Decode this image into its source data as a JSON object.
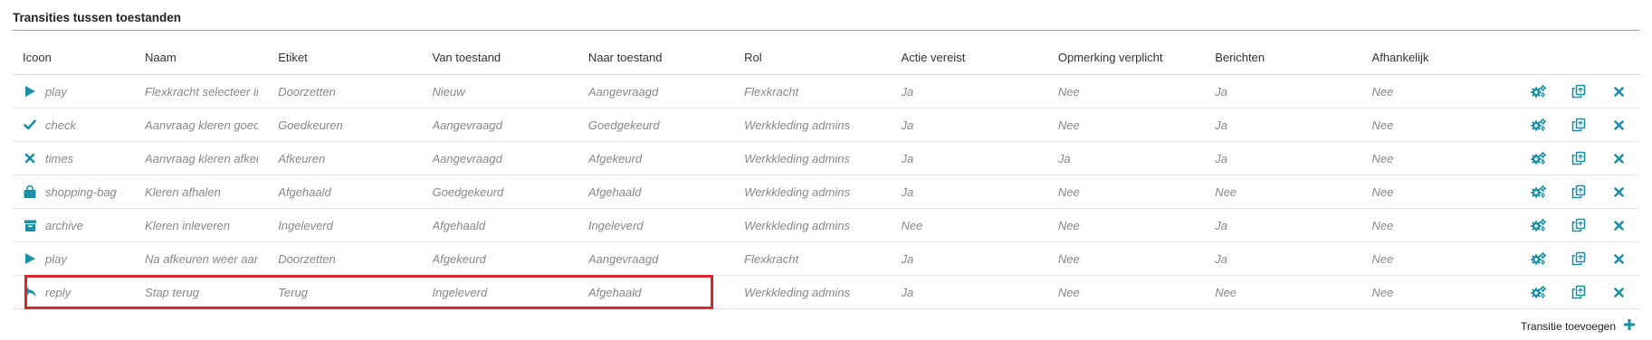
{
  "panel": {
    "title": "Transities tussen toestanden"
  },
  "table": {
    "headers": [
      "Icoon",
      "Naam",
      "Etiket",
      "Van toestand",
      "Naar toestand",
      "Rol",
      "Actie vereist",
      "Opmerking verplicht",
      "Berichten",
      "Afhankelijk"
    ],
    "rows": [
      {
        "icon": "play-icon",
        "icon_label": "play",
        "naam": "Flexkracht selecteer inlener",
        "etiket": "Doorzetten",
        "van": "Nieuw",
        "naar": "Aangevraagd",
        "rol": "Flexkracht",
        "actie": "Ja",
        "opmerking": "Nee",
        "berichten": "Ja",
        "afhankelijk": "Nee"
      },
      {
        "icon": "check-icon",
        "icon_label": "check",
        "naam": "Aanvraag kleren goedkeuren",
        "etiket": "Goedkeuren",
        "van": "Aangevraagd",
        "naar": "Goedgekeurd",
        "rol": "Werkkleding admins",
        "actie": "Ja",
        "opmerking": "Nee",
        "berichten": "Ja",
        "afhankelijk": "Nee"
      },
      {
        "icon": "times-icon",
        "icon_label": "times",
        "naam": "Aanvraag kleren afkeuren",
        "etiket": "Afkeuren",
        "van": "Aangevraagd",
        "naar": "Afgekeurd",
        "rol": "Werkkleding admins",
        "actie": "Ja",
        "opmerking": "Ja",
        "berichten": "Ja",
        "afhankelijk": "Nee"
      },
      {
        "icon": "shopping-bag-icon",
        "icon_label": "shopping-bag",
        "naam": "Kleren afhalen",
        "etiket": "Afgehaald",
        "van": "Goedgekeurd",
        "naar": "Afgehaald",
        "rol": "Werkkleding admins",
        "actie": "Ja",
        "opmerking": "Nee",
        "berichten": "Nee",
        "afhankelijk": "Nee"
      },
      {
        "icon": "archive-icon",
        "icon_label": "archive",
        "naam": "Kleren inleveren",
        "etiket": "Ingeleverd",
        "van": "Afgehaald",
        "naar": "Ingeleverd",
        "rol": "Werkkleding admins",
        "actie": "Nee",
        "opmerking": "Nee",
        "berichten": "Ja",
        "afhankelijk": "Nee"
      },
      {
        "icon": "play-icon",
        "icon_label": "play",
        "naam": "Na afkeuren weer aanvragen",
        "etiket": "Doorzetten",
        "van": "Afgekeurd",
        "naar": "Aangevraagd",
        "rol": "Flexkracht",
        "actie": "Ja",
        "opmerking": "Nee",
        "berichten": "Ja",
        "afhankelijk": "Nee"
      },
      {
        "icon": "reply-icon",
        "icon_label": "reply",
        "naam": "Stap terug",
        "etiket": "Terug",
        "van": "Ingeleverd",
        "naar": "Afgehaald",
        "rol": "Werkkleding admins",
        "actie": "Ja",
        "opmerking": "Nee",
        "berichten": "Nee",
        "afhankelijk": "Nee"
      }
    ],
    "row_actions": [
      "cogs-icon",
      "copy-icon",
      "close-icon"
    ]
  },
  "footer": {
    "add_label": "Transitie toevoegen",
    "add_icon": "plus-icon"
  },
  "colors": {
    "accent": "#1a8fa6",
    "highlight": "#e0242b",
    "muted_text": "#888888"
  }
}
